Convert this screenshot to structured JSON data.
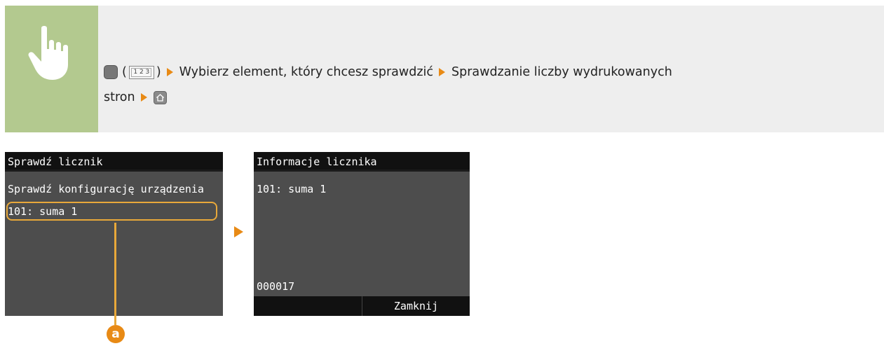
{
  "instruction": {
    "open_paren": "(",
    "counter_key_label": "1 2 3",
    "close_paren": ")",
    "step1": "Wybierz element, który chcesz sprawdzić",
    "step2": "Sprawdzanie liczby wydrukowanych",
    "step2_cont": "stron",
    "icons": [
      "pointing-hand-icon",
      "menu-key-icon",
      "counter-key-icon",
      "arrow-icon",
      "home-key-icon"
    ],
    "colors": {
      "hand_bg": "#b3c98f",
      "band_bg": "#eeeeee",
      "arrow": "#e88a15"
    }
  },
  "screen_left": {
    "title": "Sprawdź licznik",
    "items": [
      "Sprawdź konfigurację urządzenia",
      "101: suma 1"
    ],
    "selected_index": 1
  },
  "screen_right": {
    "title": "Informacje licznika",
    "counter_name": "101: suma 1",
    "counter_value": "000017",
    "close_button": "Zamknij"
  },
  "callout": {
    "label": "a",
    "color": "#e88a15"
  }
}
